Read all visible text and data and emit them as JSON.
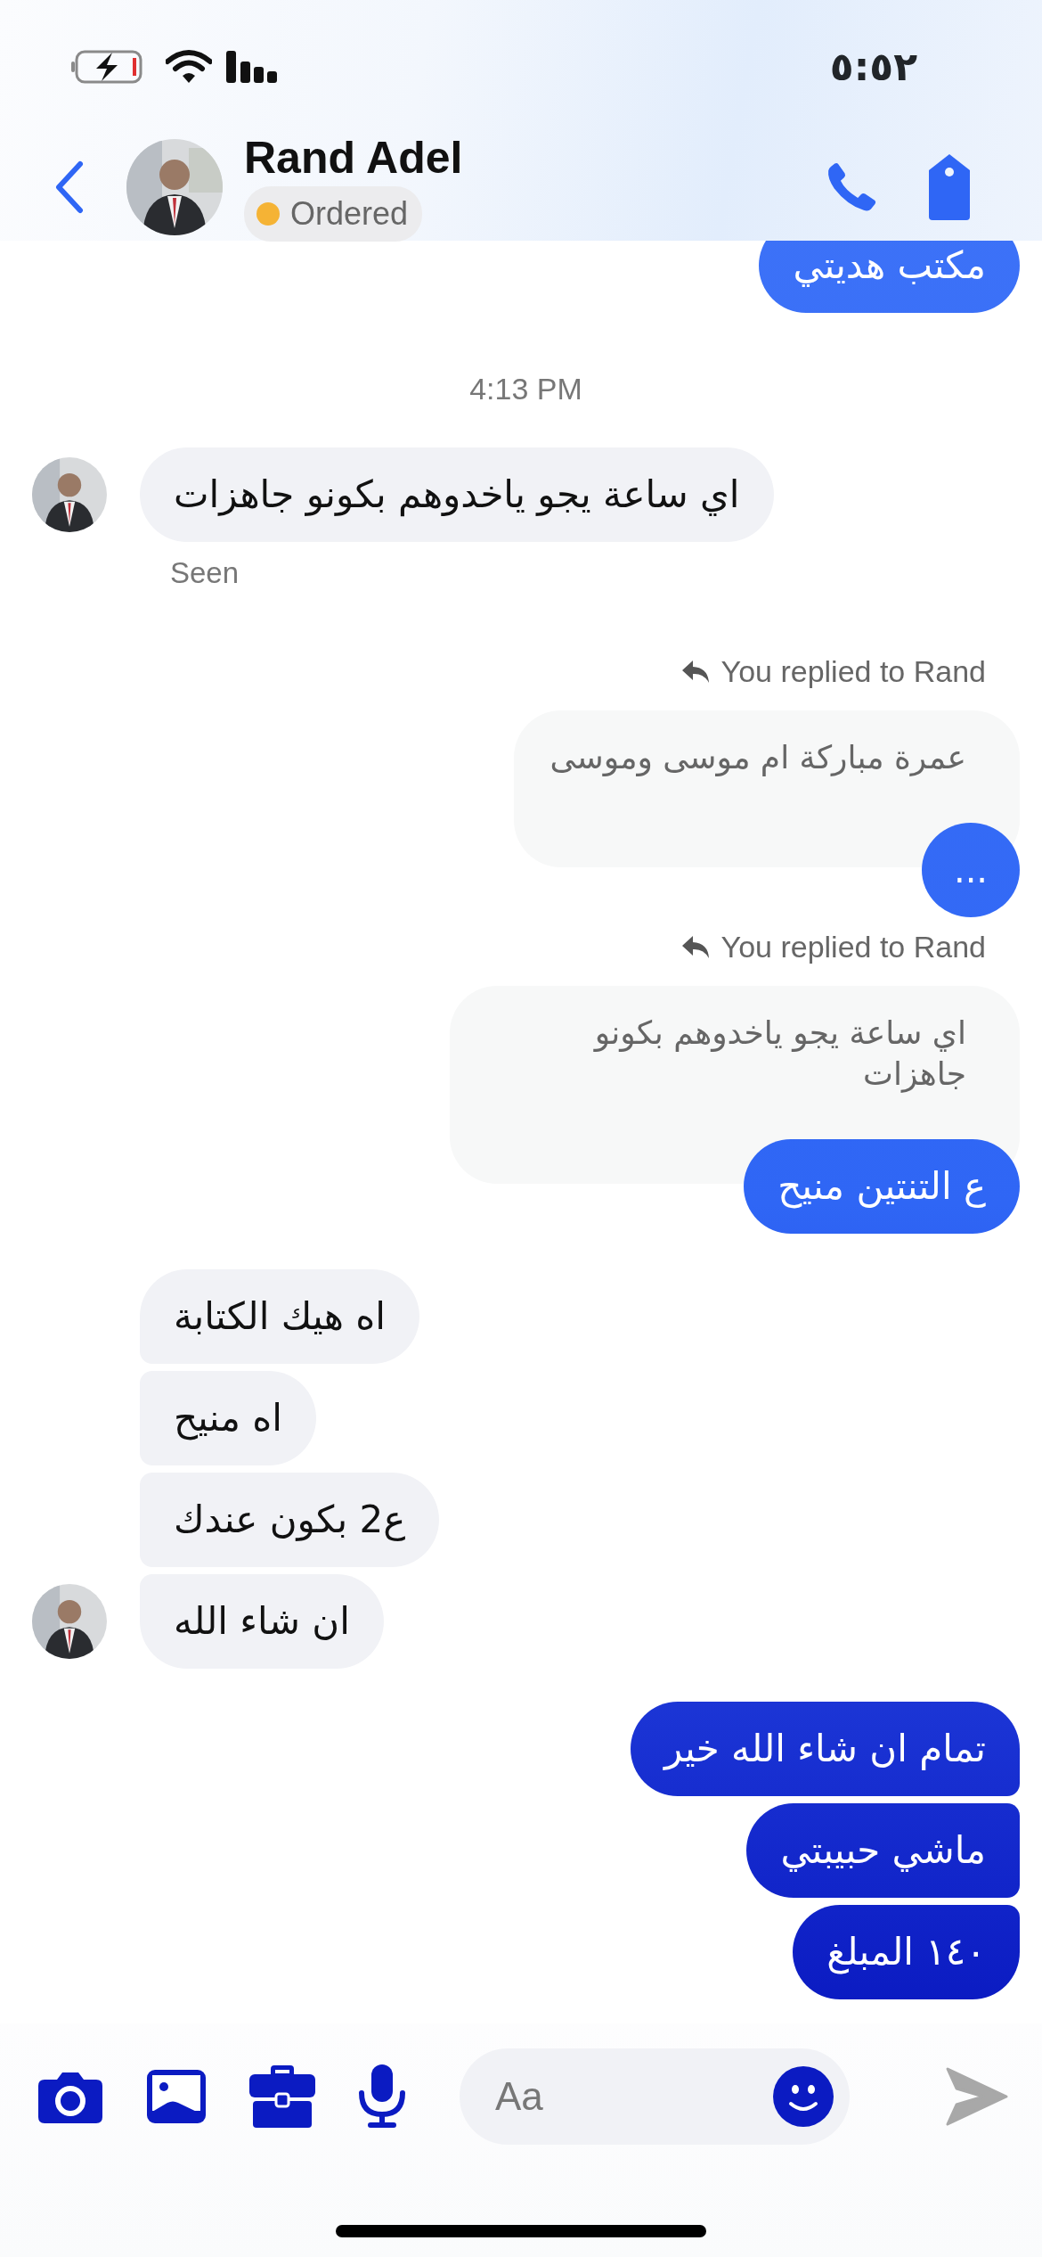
{
  "status_bar": {
    "time": "٥:٥٢"
  },
  "header": {
    "name": "Rand Adel",
    "status": "Ordered"
  },
  "messages": [
    {
      "kind": "outgoing",
      "text": "مكتب هديتي"
    },
    {
      "kind": "timestamp",
      "text": "4:13 PM"
    },
    {
      "kind": "incoming",
      "text": "اي ساعة يجو ياخدوهم بكونو جاهزات",
      "avatar": true,
      "receipt": "Seen"
    },
    {
      "kind": "reply",
      "label": "You replied to Rand",
      "quote": "عمرة مباركة ام موسى وموسى",
      "text": "..."
    },
    {
      "kind": "reply",
      "label": "You replied to Rand",
      "quote": "اي ساعة يجو ياخدوهم بكونو جاهزات",
      "text": "ع التنتين منيح"
    },
    {
      "kind": "incoming",
      "text": "اه هيك الكتابة",
      "avatar": false
    },
    {
      "kind": "incoming",
      "text": "اه منيح",
      "avatar": false
    },
    {
      "kind": "incoming",
      "text": "ع2 بكون عندك",
      "avatar": false
    },
    {
      "kind": "incoming",
      "text": "ان شاء الله",
      "avatar": true
    },
    {
      "kind": "outgoing",
      "text": "تمام ان شاء الله خير"
    },
    {
      "kind": "outgoing",
      "text": "ماشي حبيبتي"
    },
    {
      "kind": "outgoing",
      "text": "١٤٠ المبلغ"
    }
  ],
  "composer": {
    "placeholder": "Aa"
  }
}
